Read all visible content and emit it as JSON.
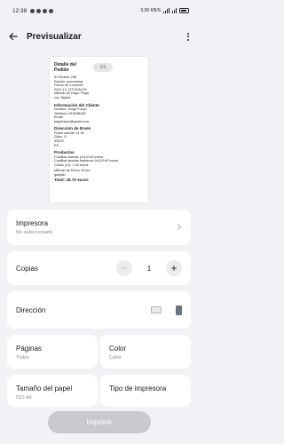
{
  "status_bar": {
    "time": "12:38",
    "right_text": "0,00 KB/S",
    "icons": [
      "notification-icon",
      "notification-icon",
      "notification-icon",
      "notification-icon"
    ]
  },
  "app_bar": {
    "title": "Previsualizar"
  },
  "preview": {
    "page_indicator": "1/1",
    "title": "Detalle del Pedido",
    "order_lines": [
      "ID Pedido: 236",
      "Estado: processing",
      "Fecha de Creación:",
      "2024-12-13T16:54:26",
      "Método de Pago: Paga",
      "con Tarjeta"
    ],
    "client_heading": "Información del Cliente",
    "client_lines": [
      "Nombre: Jorge Fueyo",
      "Teléfono: 615038438",
      "Email:",
      "jorgefueyo@gmail.com"
    ],
    "address_heading": "Dirección de Envío",
    "address_lines": [
      "Padre olavide 14 3b",
      "Gijón, O",
      "33209",
      "ES"
    ],
    "products_heading": "Productos",
    "product_lines": [
      "Costillas asadas (x1)10.60 euros",
      "Costillas asadas barbacoa (x1)10.60 euros",
      "Criollo (x1):   2.40 euros"
    ],
    "shipping_lines": [
      "Método de Envío: Envío",
      "gratuito"
    ],
    "total": "Total: 28.70 euros"
  },
  "settings": {
    "impresora": {
      "label": "Impresora",
      "value": "No seleccionado"
    },
    "copias": {
      "label": "Copias",
      "minus": "−",
      "value": "1",
      "plus": "+"
    },
    "direccion": {
      "label": "Dirección"
    },
    "paginas": {
      "label": "Páginas",
      "value": "Todos"
    },
    "color": {
      "label": "Color",
      "value": "Color"
    },
    "tamano": {
      "label": "Tamaño del papel",
      "value": "ISO A4"
    },
    "tipo": {
      "label": "Tipo de impresora",
      "value": ""
    }
  },
  "print_button": {
    "label": "Imprimir"
  },
  "colors": {
    "background": "#f2f2f6",
    "card": "#ffffff",
    "print_button_disabled": "#c9c9cd",
    "orientation_selected": "#6b7480"
  }
}
